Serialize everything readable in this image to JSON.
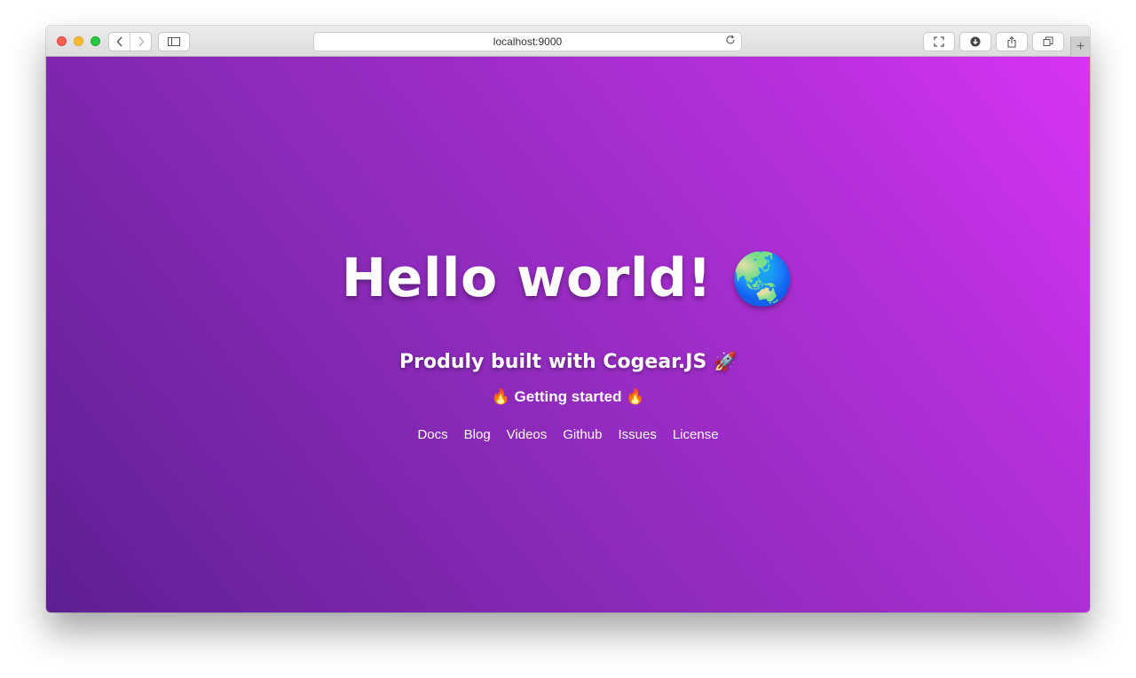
{
  "browser": {
    "url": "localhost:9000",
    "back_icon": "chevron-left-icon",
    "forward_icon": "chevron-right-icon",
    "reload_icon": "reload-icon",
    "new_tab_label": "+"
  },
  "page": {
    "title": "Hello world!",
    "title_emoji": "🌏",
    "subtitle": "Produly built with Cogear.JS",
    "subtitle_emoji": "🚀",
    "getting_started_prefix": "🔥",
    "getting_started": "Getting started",
    "getting_started_suffix": "🔥",
    "links": [
      "Docs",
      "Blog",
      "Videos",
      "Github",
      "Issues",
      "License"
    ]
  },
  "colors": {
    "gradient_start": "#5e1f93",
    "gradient_end": "#d733f4"
  }
}
